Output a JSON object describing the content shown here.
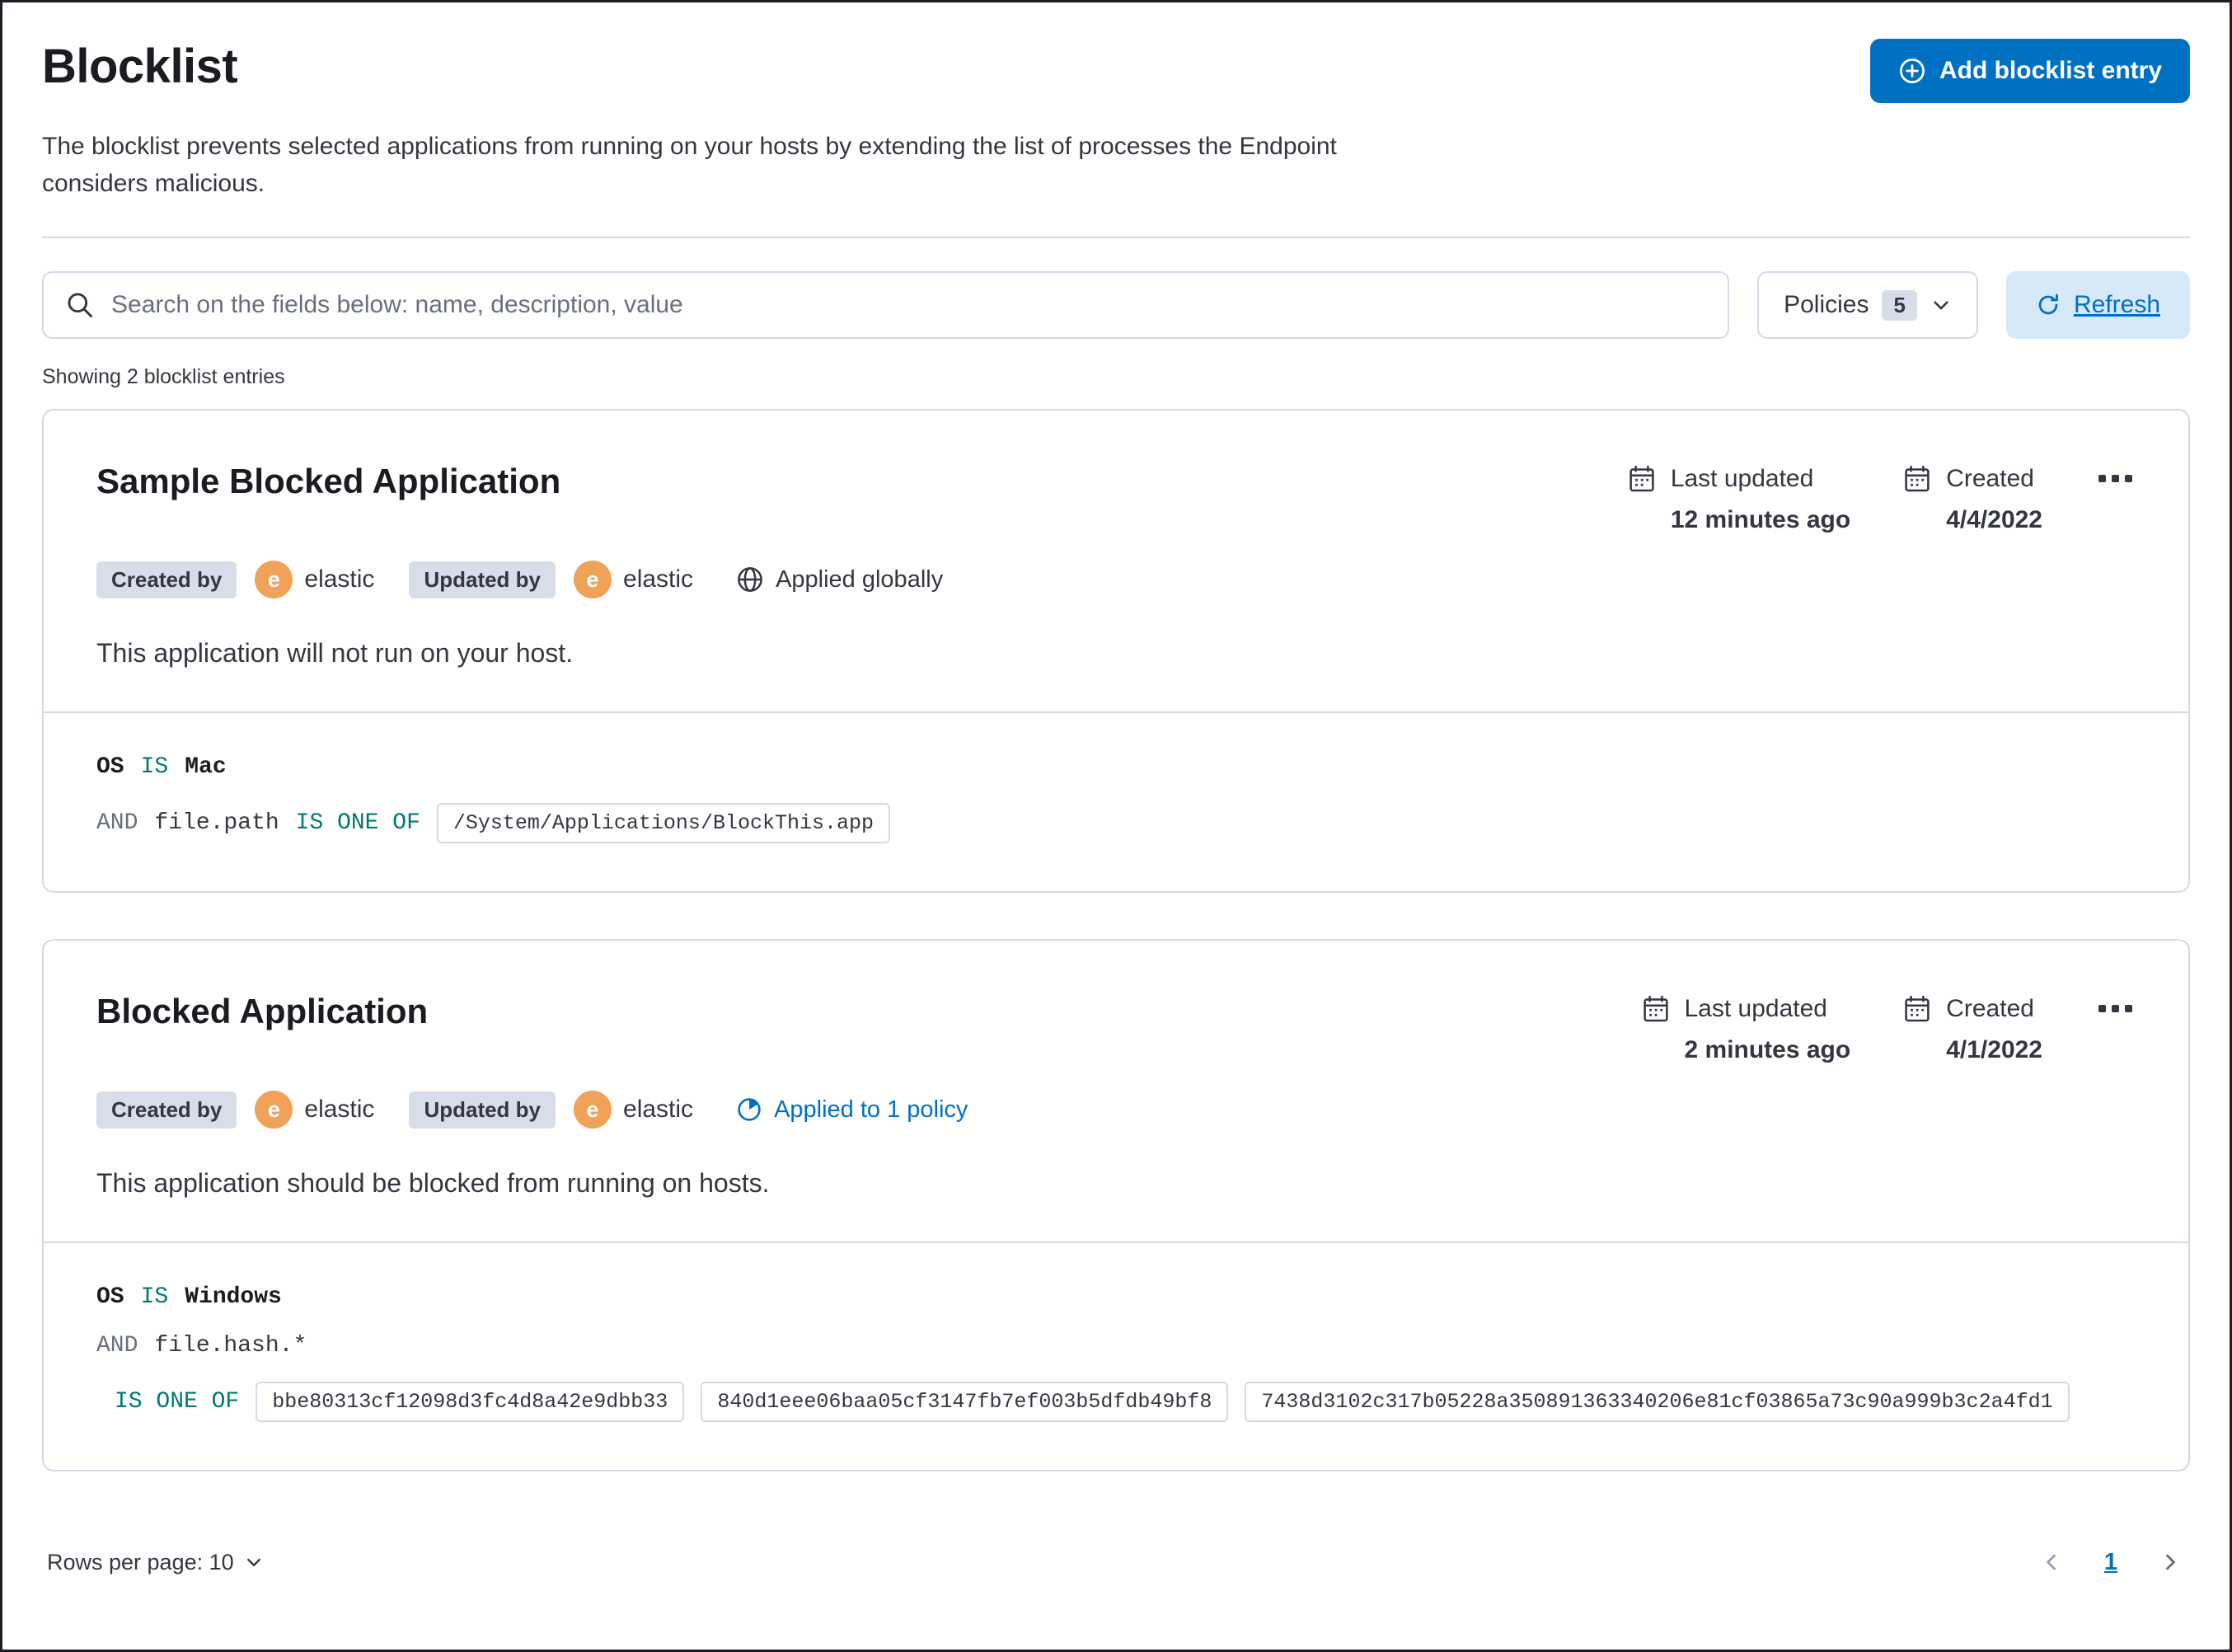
{
  "page": {
    "title": "Blocklist",
    "add_button": "Add blocklist entry",
    "description": "The blocklist prevents selected applications from running on your hosts by extending the list of processes the Endpoint considers malicious.",
    "showing_text": "Showing 2 blocklist entries"
  },
  "toolbar": {
    "search_placeholder": "Search on the fields below: name, description, value",
    "policies_label": "Policies",
    "policies_count": "5",
    "refresh_label": "Refresh"
  },
  "entries": [
    {
      "title": "Sample Blocked Application",
      "created_by_label": "Created by",
      "created_by_user": "elastic",
      "updated_by_label": "Updated by",
      "updated_by_user": "elastic",
      "avatar_initial": "e",
      "scope_label": "Applied globally",
      "last_updated_label": "Last updated",
      "last_updated_value": "12 minutes ago",
      "created_label": "Created",
      "created_value": "4/4/2022",
      "description": "This application will not run on your host.",
      "criteria": [
        {
          "field": "OS",
          "op": "IS",
          "value": "Mac"
        },
        {
          "conjunction": "AND",
          "field": "file.path",
          "op": "IS ONE OF",
          "values": [
            "/System/Applications/BlockThis.app"
          ]
        }
      ]
    },
    {
      "title": "Blocked Application",
      "created_by_label": "Created by",
      "created_by_user": "elastic",
      "updated_by_label": "Updated by",
      "updated_by_user": "elastic",
      "avatar_initial": "e",
      "scope_label": "Applied to 1 policy",
      "last_updated_label": "Last updated",
      "last_updated_value": "2 minutes ago",
      "created_label": "Created",
      "created_value": "4/1/2022",
      "description": "This application should be blocked from running on hosts.",
      "criteria": [
        {
          "field": "OS",
          "op": "IS",
          "value": "Windows"
        },
        {
          "conjunction": "AND",
          "field": "file.hash.*",
          "op": "IS ONE OF",
          "values": [
            "bbe80313cf12098d3fc4d8a42e9dbb33",
            "840d1eee06baa05cf3147fb7ef003b5dfdb49bf8",
            "7438d3102c317b05228a350891363340206e81cf03865a73c90a999b3c2a4fd1"
          ]
        }
      ]
    }
  ],
  "footer": {
    "rows_per_page": "Rows per page: 10",
    "page_number": "1"
  },
  "colors": {
    "primary": "#0071C2",
    "primary_light_bg": "#D6E9F9",
    "operator_teal": "#007871",
    "conjunction_gray": "#69707D",
    "avatar_orange": "#F0A259",
    "badge_bg": "#D8DEE9",
    "border": "#D3DAE6",
    "text": "#343741",
    "heading": "#1A1C21"
  },
  "icons": {
    "add": "plus-in-circle-icon",
    "search": "magnifier-icon",
    "policies": "chevron-down-icon",
    "refresh": "refresh-icon",
    "dates": "calendar-icon",
    "global_scope": "globe-icon",
    "policy_scope": "partial-circle-icon",
    "actions": "ellipsis-icon",
    "prev": "chevron-left-icon",
    "next": "chevron-right-icon"
  }
}
